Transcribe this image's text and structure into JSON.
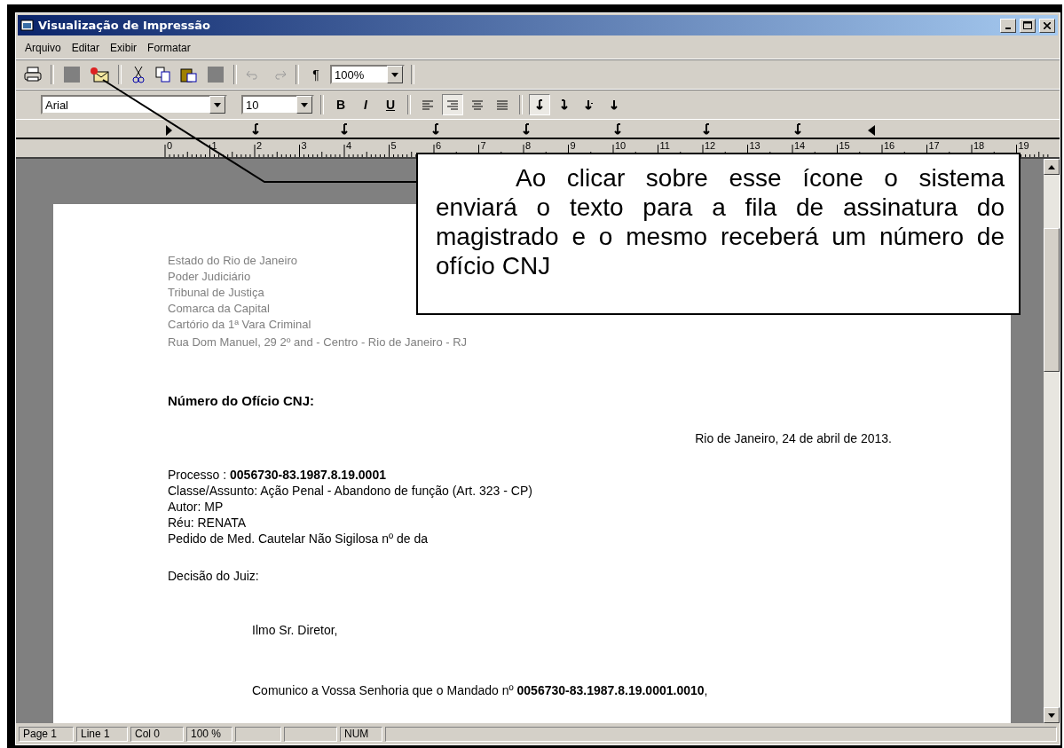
{
  "window": {
    "title": "Visualização de Impressão"
  },
  "menu": [
    {
      "label": "Arquivo"
    },
    {
      "label": "Editar"
    },
    {
      "label": "Exibir"
    },
    {
      "label": "Formatar"
    }
  ],
  "toolbar": {
    "zoom": "100%",
    "paragraph": "¶"
  },
  "format_bar": {
    "font": "Arial",
    "size": "10",
    "bold": "B",
    "italic": "I",
    "underline": "U",
    "align": [
      {
        "selected": false
      },
      {
        "selected": true
      },
      {
        "selected": false
      },
      {
        "selected": false
      }
    ],
    "tabs": [
      {
        "selected": true
      },
      {
        "selected": false
      },
      {
        "selected": false
      },
      {
        "selected": false
      }
    ]
  },
  "ruler": {
    "labels": [
      "0",
      "1",
      "2",
      "3",
      "4",
      "5",
      "6",
      "7",
      "8",
      "9",
      "10",
      "11",
      "12",
      "13",
      "14",
      "15",
      "16",
      "17",
      "18",
      "19"
    ]
  },
  "document": {
    "letterhead": [
      "Estado do Rio de Janeiro",
      "Poder Judiciário",
      "Tribunal de Justiça",
      "Comarca da Capital",
      "Cartório da 1ª Vara Criminal",
      "Rua Dom Manuel, 29 2º and  - Centro - Rio de Janeiro - RJ"
    ],
    "heading": "Número do Ofício CNJ:",
    "date": "Rio de Janeiro, 24 de abril de 2013.",
    "details": [
      "Processo : **0056730-83.1987.8.19.0001**",
      "Classe/Assunto: Ação Penal - Abandono de função  (Art. 323 - CP)",
      "Autor: MP",
      "Réu: RENATA",
      "Pedido de Med. Cautelar Não Sigilosa nº  de  da"
    ],
    "decision": "Decisão do Juiz:",
    "salutation": "Ilmo Sr. Diretor,",
    "body": "Comunico a Vossa Senhoria que o Mandado nº **0056730-83.1987.8.19.0001.0010**,"
  },
  "callout": {
    "text": "Ao clicar sobre esse ícone o sistema enviará o texto para a fila de assinatura do magistrado e o mesmo receberá um número de ofício CNJ"
  },
  "status_bar": [
    {
      "label": "Page 1"
    },
    {
      "label": "Line 1"
    },
    {
      "label": "Col 0"
    },
    {
      "label": "100 %"
    },
    {
      "label": "NUM"
    }
  ]
}
